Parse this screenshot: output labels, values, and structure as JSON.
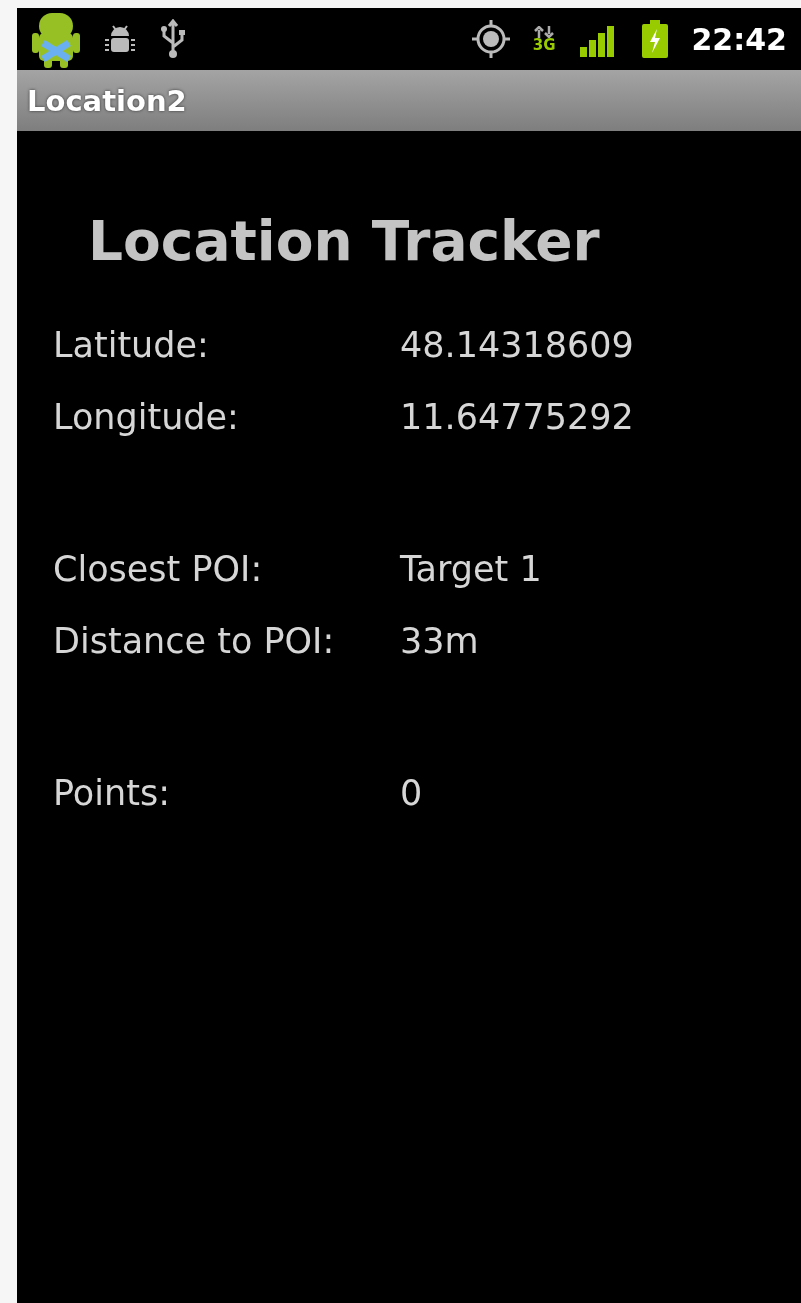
{
  "status_bar": {
    "network": "3G",
    "time": "22:42"
  },
  "window": {
    "title": "Location2"
  },
  "heading": "Location Tracker",
  "groups": [
    {
      "rows": [
        {
          "label": "Latitude:",
          "value": "48.14318609"
        },
        {
          "label": "Longitude:",
          "value": "11.64775292"
        }
      ]
    },
    {
      "rows": [
        {
          "label": "Closest POI:",
          "value": "Target 1"
        },
        {
          "label": "Distance to POI:",
          "value": "33m"
        }
      ]
    },
    {
      "rows": [
        {
          "label": "Points:",
          "value": "0"
        }
      ]
    }
  ]
}
